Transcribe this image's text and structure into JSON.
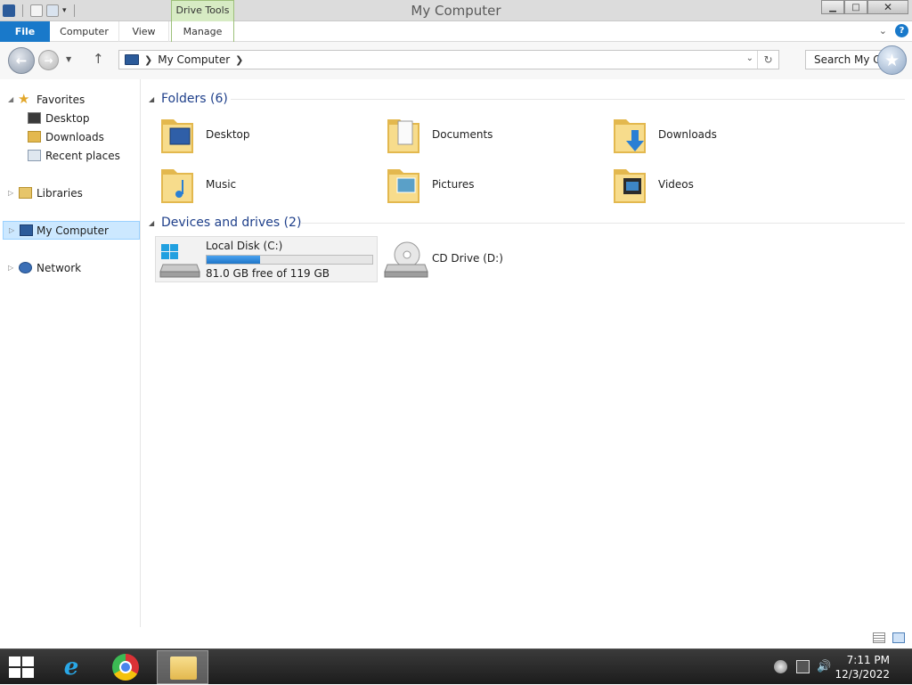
{
  "window": {
    "title": "My Computer",
    "contextual_tab": "Drive Tools",
    "buttons": {
      "minimize": "▁",
      "maximize": "□",
      "close": "✕"
    }
  },
  "ribbon": {
    "tabs": [
      "File",
      "Computer",
      "View",
      "Manage"
    ],
    "help": "?"
  },
  "address": {
    "path": "My Computer",
    "search_placeholder": "Search My C..."
  },
  "nav_pane": {
    "favorites": "Favorites",
    "favorite_items": [
      "Desktop",
      "Downloads",
      "Recent places"
    ],
    "libraries": "Libraries",
    "my_computer": "My Computer",
    "network": "Network"
  },
  "content": {
    "folders_header": "Folders (6)",
    "folders": [
      "Desktop",
      "Documents",
      "Downloads",
      "Music",
      "Pictures",
      "Videos"
    ],
    "devices_header": "Devices and drives (2)",
    "drives": [
      {
        "name": "Local Disk (C:)",
        "free_text": "81.0 GB free of 119 GB",
        "used_fraction": 0.32
      },
      {
        "name": "CD Drive (D:)"
      }
    ]
  },
  "taskbar": {
    "time": "7:11 PM",
    "date": "12/3/2022"
  },
  "colors": {
    "accent": "#1979ca",
    "group_header": "#1e3f8a",
    "contextual_tab": "#d7ebc4",
    "selection": "#cce8ff"
  }
}
